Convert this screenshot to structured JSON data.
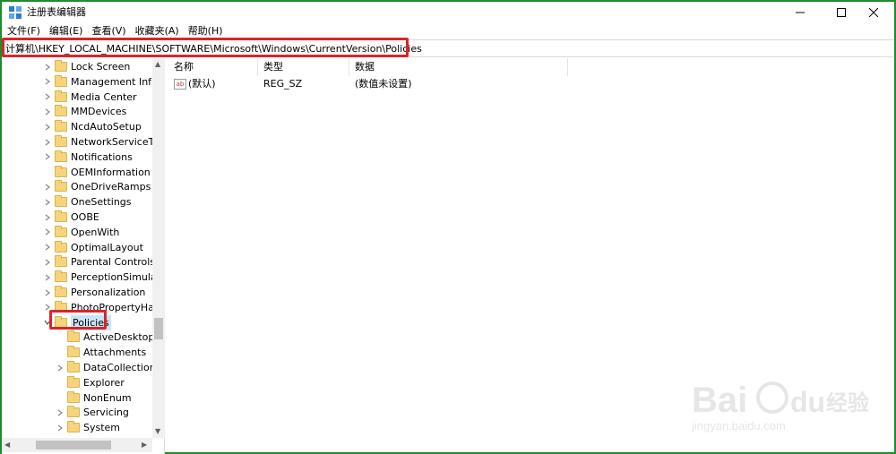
{
  "window": {
    "title": "注册表编辑器",
    "minimize_icon": "minimize-icon",
    "maximize_icon": "maximize-icon",
    "close_icon": "close-icon"
  },
  "menu": [
    "文件(F)",
    "编辑(E)",
    "查看(V)",
    "收藏夹(A)",
    "帮助(H)"
  ],
  "address": {
    "path": "计算机\\HKEY_LOCAL_MACHINE\\SOFTWARE\\Microsoft\\Windows\\CurrentVersion\\Policies"
  },
  "tree": {
    "items": [
      {
        "label": "Lock Screen",
        "expandable": true
      },
      {
        "label": "Management Infra",
        "expandable": true
      },
      {
        "label": "Media Center",
        "expandable": true
      },
      {
        "label": "MMDevices",
        "expandable": true
      },
      {
        "label": "NcdAutoSetup",
        "expandable": true
      },
      {
        "label": "NetworkServiceTrig",
        "expandable": true
      },
      {
        "label": "Notifications",
        "expandable": true
      },
      {
        "label": "OEMInformation",
        "expandable": false
      },
      {
        "label": "OneDriveRamps",
        "expandable": true
      },
      {
        "label": "OneSettings",
        "expandable": true
      },
      {
        "label": "OOBE",
        "expandable": true
      },
      {
        "label": "OpenWith",
        "expandable": true
      },
      {
        "label": "OptimalLayout",
        "expandable": true
      },
      {
        "label": "Parental Controls",
        "expandable": true
      },
      {
        "label": "PerceptionSimulatio",
        "expandable": true
      },
      {
        "label": "Personalization",
        "expandable": true
      },
      {
        "label": "PhotoPropertyHand",
        "expandable": true
      },
      {
        "label": "Policies",
        "expandable": true,
        "expanded": true,
        "selected": true
      },
      {
        "label": "ActiveDesktop",
        "expandable": false,
        "child": true
      },
      {
        "label": "Attachments",
        "expandable": false,
        "child": true
      },
      {
        "label": "DataCollection",
        "expandable": true,
        "child": true
      },
      {
        "label": "Explorer",
        "expandable": false,
        "child": true
      },
      {
        "label": "NonEnum",
        "expandable": false,
        "child": true
      },
      {
        "label": "Servicing",
        "expandable": true,
        "child": true
      },
      {
        "label": "System",
        "expandable": true,
        "child": true
      }
    ]
  },
  "list": {
    "columns": [
      "名称",
      "类型",
      "数据"
    ],
    "rows": [
      {
        "name": "(默认)",
        "type": "REG_SZ",
        "data": "(数值未设置)",
        "icon": "ab-icon"
      }
    ]
  },
  "colors": {
    "frame_border": "#1d8c2c",
    "highlight_box": "#d9242b",
    "folder": "#f6d47b",
    "selection": "#cce4f7"
  }
}
